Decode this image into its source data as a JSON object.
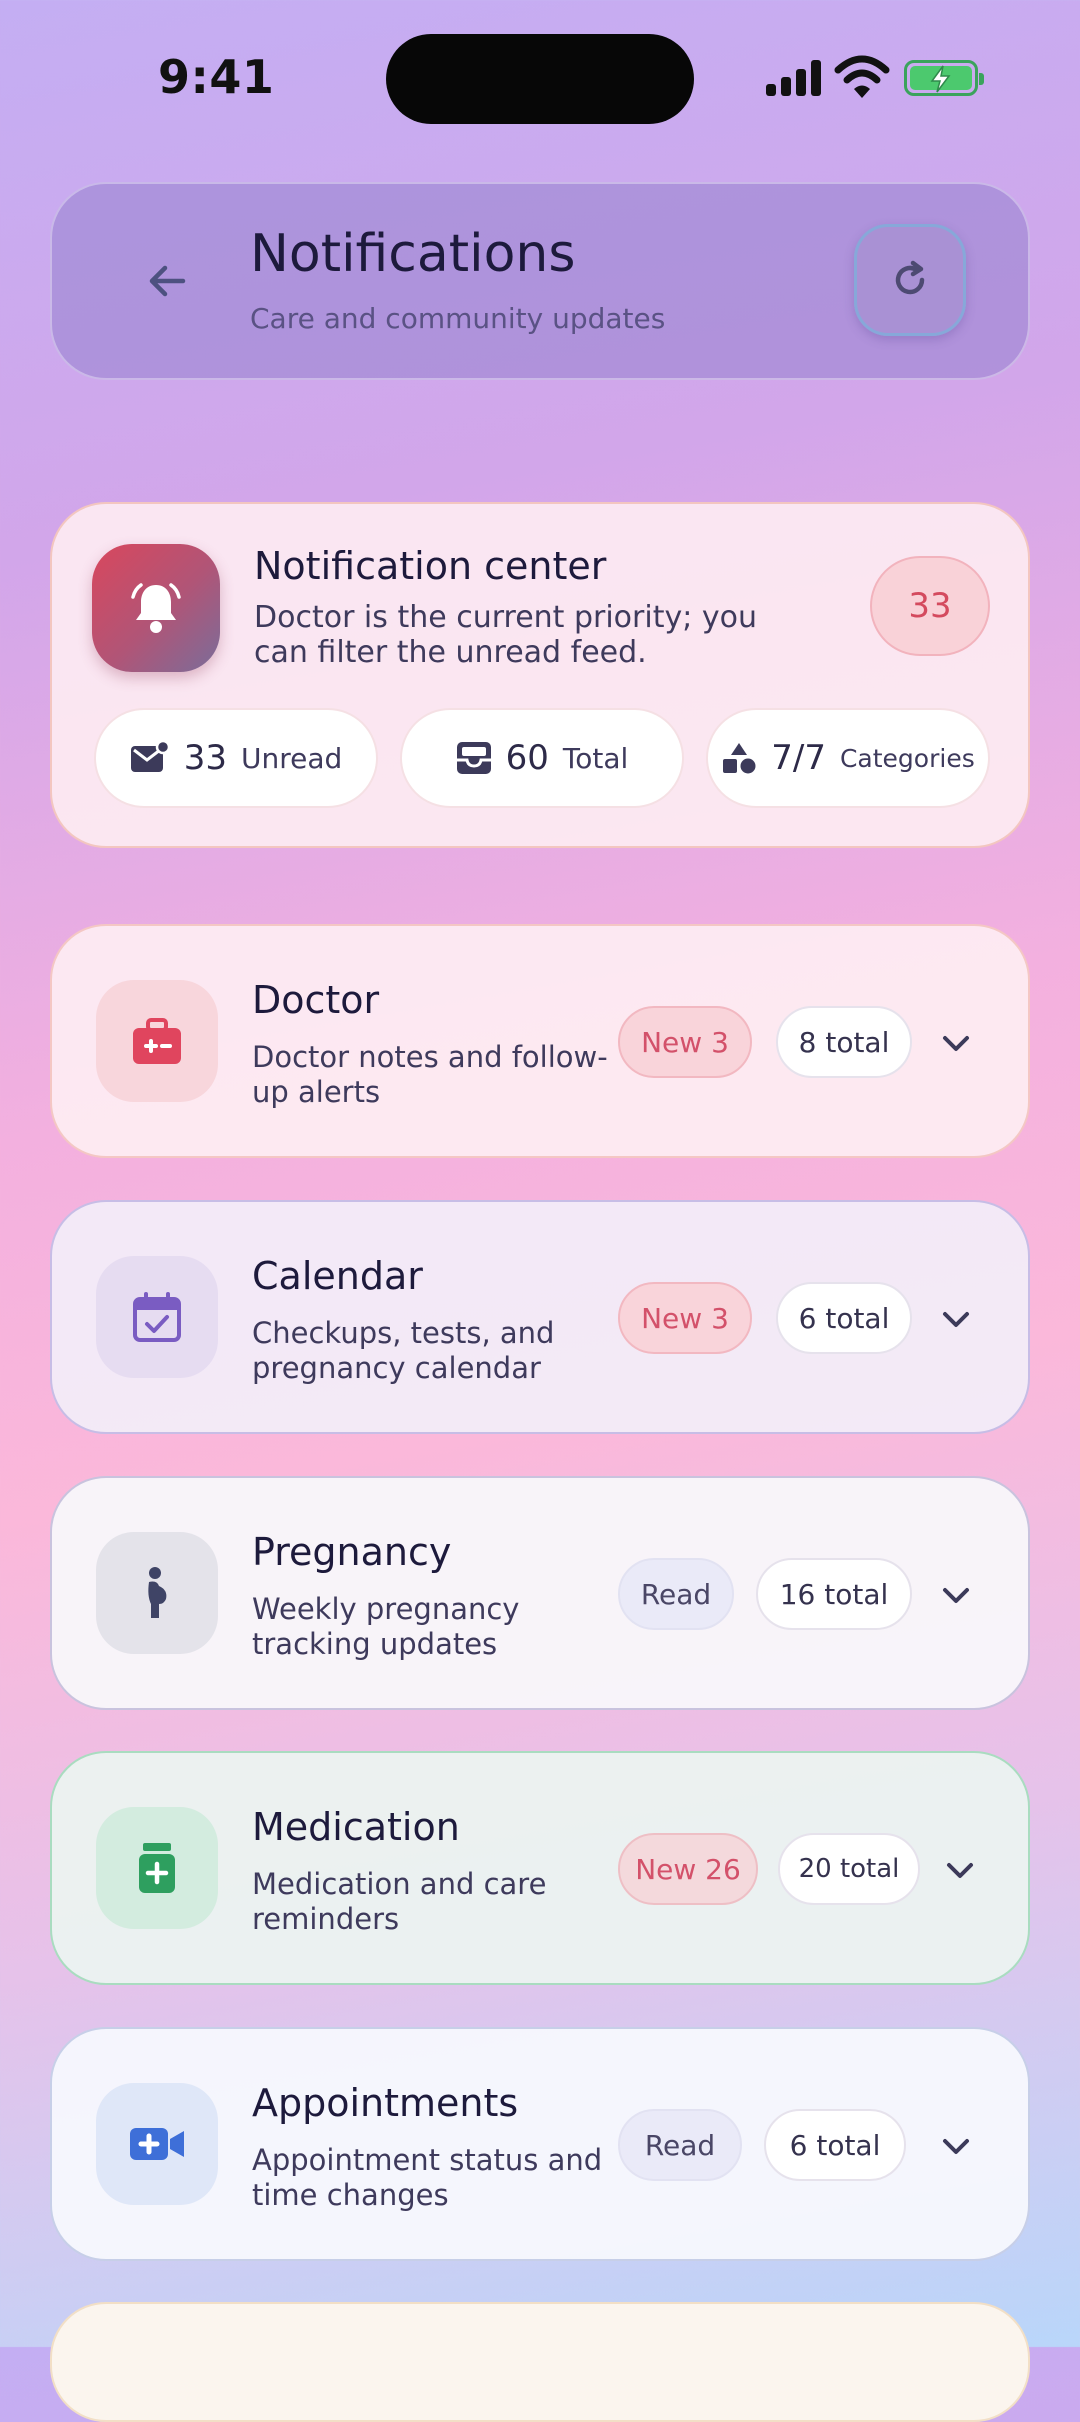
{
  "status_bar": {
    "time": "9:41"
  },
  "header": {
    "title": "Notifications",
    "subtitle": "Care and community updates",
    "back_icon": "arrow-left-icon",
    "refresh_icon": "refresh-icon"
  },
  "center": {
    "title": "Notification center",
    "description": "Doctor is the current priority; you can filter the unread feed.",
    "count": "33",
    "stats": [
      {
        "value": "33",
        "label": "Unread",
        "icon": "mail-icon"
      },
      {
        "value": "60",
        "label": "Total",
        "icon": "inbox-icon"
      },
      {
        "value": "7/7",
        "label": "Categories",
        "icon": "shapes-icon"
      }
    ]
  },
  "categories": [
    {
      "name": "Doctor",
      "description": "Doctor notes and follow-up alerts",
      "status": "New 3",
      "total": "8 total",
      "icon": "medical-kit-icon",
      "accent": "#e0455e"
    },
    {
      "name": "Calendar",
      "description": "Checkups, tests, and pregnancy calendar",
      "status": "New 3",
      "total": "6 total",
      "icon": "calendar-check-icon",
      "accent": "#7a5cc2"
    },
    {
      "name": "Pregnancy",
      "description": "Weekly pregnancy tracking updates",
      "status": "Read",
      "total": "16 total",
      "icon": "pregnant-person-icon",
      "accent": "#3f4466"
    },
    {
      "name": "Medication",
      "description": "Medication and care reminders",
      "status": "New 26",
      "total": "20 total",
      "icon": "pill-bottle-icon",
      "accent": "#2e9f5f"
    },
    {
      "name": "Appointments",
      "description": "Appointment status and time changes",
      "status": "Read",
      "total": "6 total",
      "icon": "video-medical-icon",
      "accent": "#3e6fd8"
    }
  ]
}
